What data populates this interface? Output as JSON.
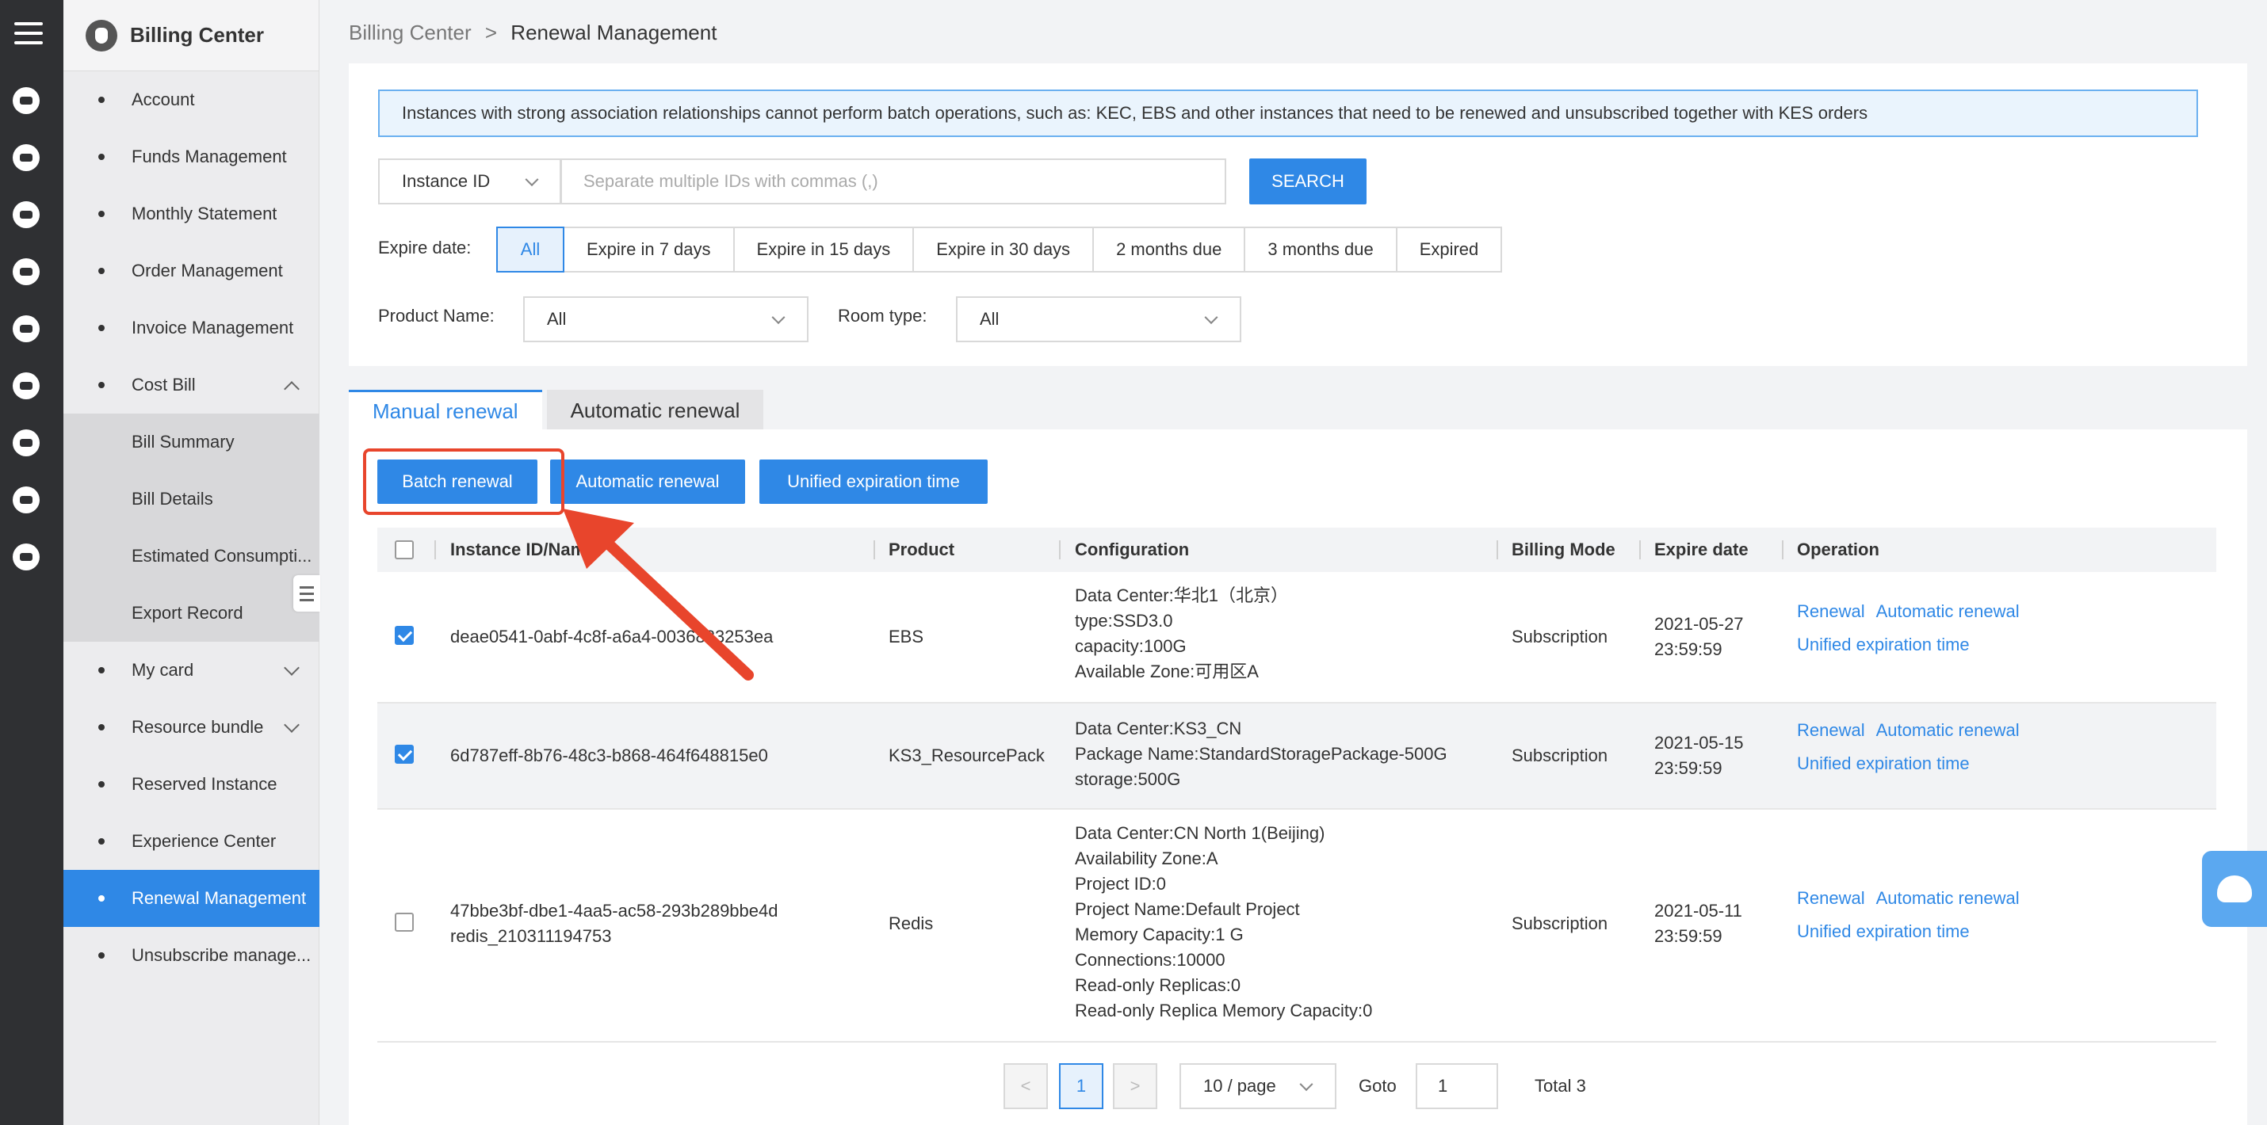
{
  "sidebar": {
    "title": "Billing Center",
    "items": [
      {
        "label": "Account"
      },
      {
        "label": "Funds Management"
      },
      {
        "label": "Monthly Statement"
      },
      {
        "label": "Order Management"
      },
      {
        "label": "Invoice Management"
      },
      {
        "label": "Cost Bill"
      },
      {
        "label": "Bill Summary"
      },
      {
        "label": "Bill Details"
      },
      {
        "label": "Estimated Consumpti..."
      },
      {
        "label": "Export Record"
      },
      {
        "label": "My card"
      },
      {
        "label": "Resource bundle"
      },
      {
        "label": "Reserved Instance"
      },
      {
        "label": "Experience Center"
      },
      {
        "label": "Renewal Management"
      },
      {
        "label": "Unsubscribe manage..."
      }
    ]
  },
  "breadcrumb": {
    "root": "Billing Center",
    "sep": ">",
    "current": "Renewal Management"
  },
  "notice": "Instances with strong association relationships cannot perform batch operations, such as: KEC, EBS and other instances that need to be renewed and unsubscribed together with KES orders",
  "search": {
    "field_select": "Instance ID",
    "placeholder": "Separate multiple IDs with commas (,)",
    "button": "SEARCH"
  },
  "filters": {
    "expire_label": "Expire date:",
    "expire_options": [
      "All",
      "Expire in 7 days",
      "Expire in 15 days",
      "Expire in 30 days",
      "2 months due",
      "3 months due",
      "Expired"
    ],
    "product_label": "Product Name:",
    "product_value": "All",
    "room_label": "Room type:",
    "room_value": "All"
  },
  "tabs": [
    "Manual renewal",
    "Automatic renewal"
  ],
  "actions": [
    "Batch renewal",
    "Automatic renewal",
    "Unified expiration time"
  ],
  "table": {
    "columns": [
      "Instance ID/Name",
      "Product",
      "Configuration",
      "Billing Mode",
      "Expire date",
      "Operation"
    ],
    "rows": [
      {
        "checked": true,
        "id": "deae0541-0abf-4c8f-a6a4-0036883253ea",
        "name": "",
        "product": "EBS",
        "config": [
          "Data Center:华北1（北京）",
          "type:SSD3.0",
          "capacity:100G",
          "Available Zone:可用区A"
        ],
        "billing": "Subscription",
        "expire_date": "2021-05-27",
        "expire_time": "23:59:59",
        "ops": [
          "Renewal",
          "Automatic renewal",
          "Unified expiration time"
        ]
      },
      {
        "checked": true,
        "id": "6d787eff-8b76-48c3-b868-464f648815e0",
        "name": "",
        "product": "KS3_ResourcePack",
        "config": [
          "Data Center:KS3_CN",
          "Package Name:StandardStoragePackage-500G",
          "storage:500G"
        ],
        "billing": "Subscription",
        "expire_date": "2021-05-15",
        "expire_time": "23:59:59",
        "ops": [
          "Renewal",
          "Automatic renewal",
          "Unified expiration time"
        ]
      },
      {
        "checked": false,
        "id": "47bbe3bf-dbe1-4aa5-ac58-293b289bbe4d",
        "name": "redis_210311194753",
        "product": "Redis",
        "config": [
          "Data Center:CN North 1(Beijing)",
          "Availability Zone:A",
          "Project ID:0",
          "Project Name:Default Project",
          "Memory Capacity:1 G",
          "Connections:10000",
          "Read-only Replicas:0",
          "Read-only Replica Memory Capacity:0"
        ],
        "billing": "Subscription",
        "expire_date": "2021-05-11",
        "expire_time": "23:59:59",
        "ops": [
          "Renewal",
          "Automatic renewal",
          "Unified expiration time"
        ]
      }
    ]
  },
  "pagination": {
    "prev": "<",
    "next": ">",
    "current_page": "1",
    "page_size": "10 / page",
    "goto_label": "Goto",
    "goto_value": "1",
    "total": "Total 3"
  },
  "colors": {
    "primary": "#2f88e6",
    "highlight": "#e8452c"
  }
}
